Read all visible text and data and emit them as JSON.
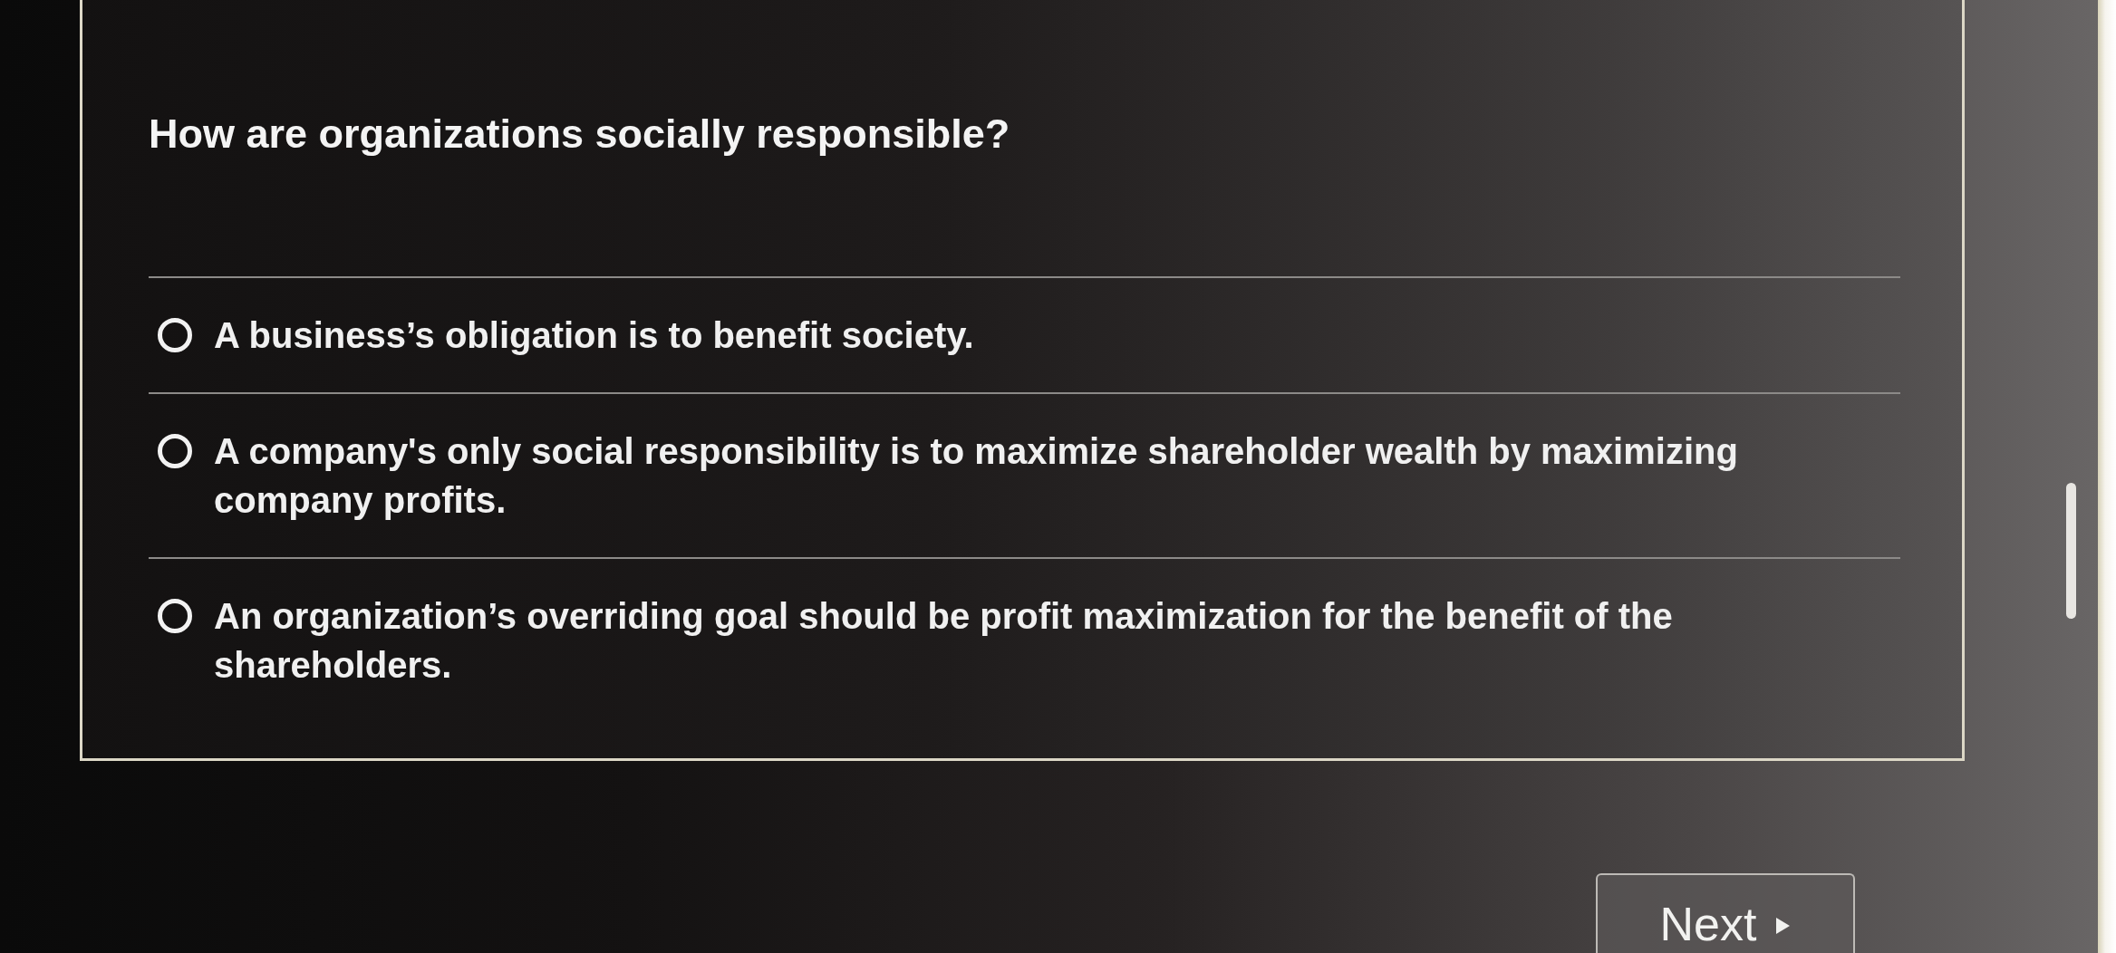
{
  "question": {
    "text": "How are organizations socially responsible?"
  },
  "options": [
    {
      "label": "A business’s obligation is to benefit society.",
      "selected": false
    },
    {
      "label": "A company's only social responsibility is to maximize shareholder wealth by maximizing company profits.",
      "selected": false
    },
    {
      "label": "An organization’s overriding goal should be profit maximization for the benefit of the shareholders.",
      "selected": false
    }
  ],
  "next_button": {
    "label": "Next"
  }
}
